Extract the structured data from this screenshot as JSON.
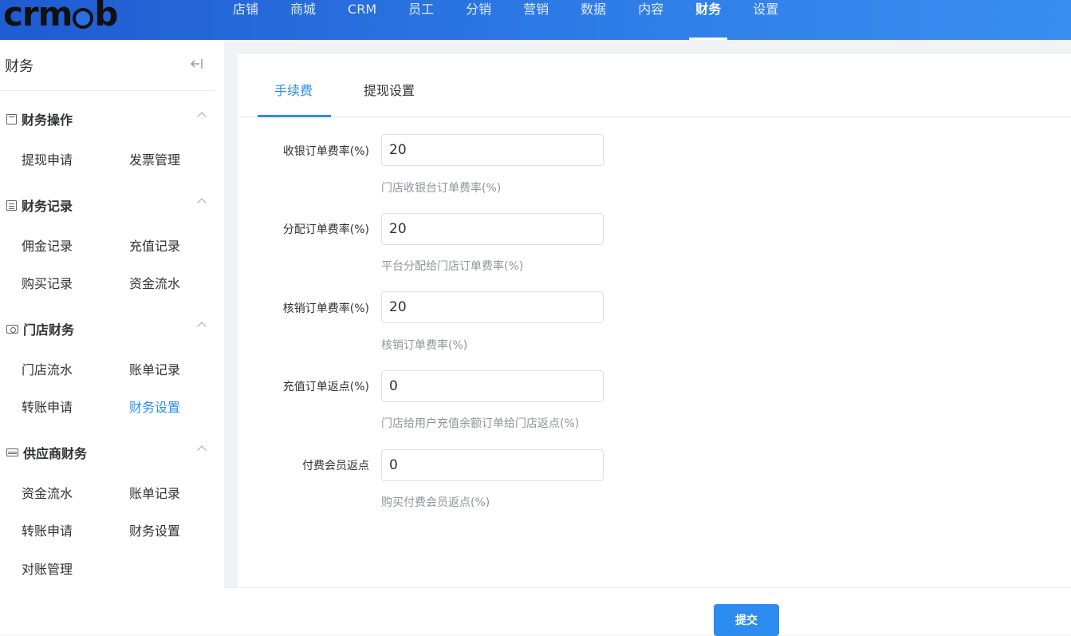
{
  "brand": {
    "logo_text_a": "crm",
    "logo_text_b": "b"
  },
  "topnav": [
    {
      "label": "店铺"
    },
    {
      "label": "商城"
    },
    {
      "label": "CRM"
    },
    {
      "label": "员工"
    },
    {
      "label": "分销"
    },
    {
      "label": "营销"
    },
    {
      "label": "数据"
    },
    {
      "label": "内容"
    },
    {
      "label": "财务",
      "active": true
    },
    {
      "label": "设置"
    }
  ],
  "sidebar": {
    "title": "财务",
    "collapse_icon": "collapse-left-icon",
    "groups": [
      {
        "title": "财务操作",
        "icon": "document-icon",
        "items": [
          "提现申请",
          "发票管理"
        ]
      },
      {
        "title": "财务记录",
        "icon": "list-icon",
        "items": [
          "佣金记录",
          "充值记录",
          "购买记录",
          "资金流水"
        ]
      },
      {
        "title": "门店财务",
        "icon": "store-icon",
        "items": [
          "门店流水",
          "账单记录",
          "转账申请",
          "财务设置"
        ]
      },
      {
        "title": "供应商财务",
        "icon": "card-icon",
        "items": [
          "资金流水",
          "账单记录",
          "转账申请",
          "财务设置",
          "对账管理"
        ]
      }
    ],
    "active_item": "财务设置"
  },
  "tabs": [
    {
      "label": "手续费",
      "active": true
    },
    {
      "label": "提现设置"
    }
  ],
  "form": {
    "fields": [
      {
        "label": "收银订单费率(%)",
        "value": "20",
        "help": "门店收银台订单费率(%)"
      },
      {
        "label": "分配订单费率(%)",
        "value": "20",
        "help": "平台分配给门店订单费率(%)"
      },
      {
        "label": "核销订单费率(%)",
        "value": "20",
        "help": "核销订单费率(%)"
      },
      {
        "label": "充值订单返点(%)",
        "value": "0",
        "help": "门店给用户充值余额订单给门店返点(%)"
      },
      {
        "label": "付费会员返点",
        "value": "0",
        "help": "购买付费会员返点(%)"
      }
    ]
  },
  "footer": {
    "submit_label": "提交"
  },
  "colors": {
    "accent": "#2d8cf0",
    "header_start": "#1f5bd1",
    "header_end": "#3a8ef0"
  }
}
